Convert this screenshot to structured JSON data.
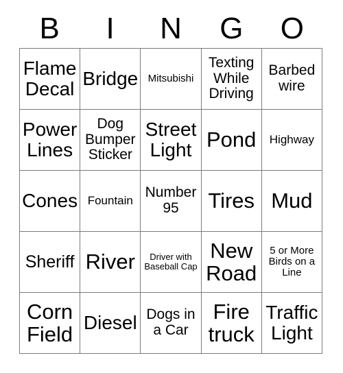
{
  "card": {
    "header_letters": [
      "B",
      "I",
      "N",
      "G",
      "O"
    ],
    "columns": 5,
    "rows": 5,
    "border_color": "#7a7a7a",
    "text_color": "#000000",
    "background_color": "#ffffff",
    "cells": [
      [
        {
          "text": "Flame Decal",
          "size": "fs-xl"
        },
        {
          "text": "Bridge",
          "size": "fs-xl"
        },
        {
          "text": "Mitsubishi",
          "size": "fs-xs"
        },
        {
          "text": "Texting While Driving",
          "size": "fs-m"
        },
        {
          "text": "Barbed wire",
          "size": "fs-m"
        }
      ],
      [
        {
          "text": "Power Lines",
          "size": "fs-xl"
        },
        {
          "text": "Dog Bumper Sticker",
          "size": "fs-m"
        },
        {
          "text": "Street Light",
          "size": "fs-xl"
        },
        {
          "text": "Pond",
          "size": "fs-xxl"
        },
        {
          "text": "Highway",
          "size": "fs-s"
        }
      ],
      [
        {
          "text": "Cones",
          "size": "fs-xl"
        },
        {
          "text": "Fountain",
          "size": "fs-s"
        },
        {
          "text": "Number 95",
          "size": "fs-m"
        },
        {
          "text": "Tires",
          "size": "fs-xxl"
        },
        {
          "text": "Mud",
          "size": "fs-xxl"
        }
      ],
      [
        {
          "text": "Sheriff",
          "size": "fs-l"
        },
        {
          "text": "River",
          "size": "fs-xxl"
        },
        {
          "text": "Driver with Baseball Cap",
          "size": "fs-xxs"
        },
        {
          "text": "New Road",
          "size": "fs-xxl"
        },
        {
          "text": "5 or More Birds on a Line",
          "size": "fs-xs"
        }
      ],
      [
        {
          "text": "Corn Field",
          "size": "fs-xxl"
        },
        {
          "text": "Diesel",
          "size": "fs-xl"
        },
        {
          "text": "Dogs in a Car",
          "size": "fs-m"
        },
        {
          "text": "Fire truck",
          "size": "fs-xxl"
        },
        {
          "text": "Traffic Light",
          "size": "fs-xl"
        }
      ]
    ]
  }
}
